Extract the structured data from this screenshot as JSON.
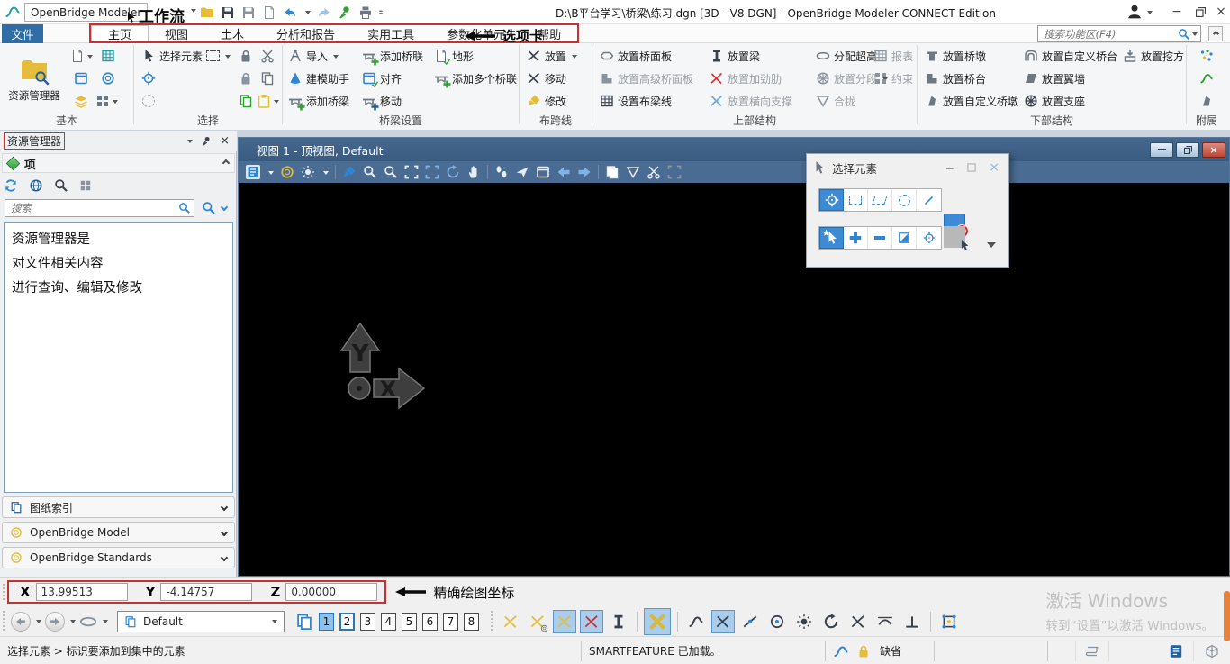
{
  "titlebar": {
    "app_button": "OpenBridge Modeler",
    "workflow_note": "工作流",
    "doc_title": "D:\\B平台学习\\桥梁\\练习.dgn [3D - V8 DGN] - OpenBridge Modeler CONNECT Edition"
  },
  "tabrow": {
    "file_tab": "文件",
    "tabs": [
      "主页",
      "视图",
      "土木",
      "分析和报告",
      "实用工具",
      "参数化单元",
      "帮助"
    ],
    "tabs_note": "选项卡",
    "search_placeholder": "搜索功能区(F4)"
  },
  "ribbon": {
    "basic": {
      "label": "基本",
      "explorer": "资源管理器"
    },
    "select": {
      "label": "选择",
      "select_element": "选择元素"
    },
    "bridge_setup": {
      "label": "桥梁设置",
      "import": "导入",
      "assistant": "建模助手",
      "add_bridge": "添加桥梁",
      "add_unit": "添加桥联",
      "align": "对齐",
      "move": "移动",
      "terrain": "地形",
      "add_multi": "添加多个桥联"
    },
    "span_line": {
      "label": "布跨线",
      "place": "放置",
      "move": "移动",
      "modify": "修改"
    },
    "superstructure": {
      "label": "上部结构",
      "deck": "放置桥面板",
      "adv_deck": "放置高级桥面板",
      "beam_layout": "设置布梁线",
      "beam": "放置梁",
      "stiffener": "放置加劲肋",
      "cross_frame": "放置横向支撑",
      "superelevation": "分配超高",
      "segment": "放置分段",
      "closure": "合拢",
      "report": "报表",
      "constraint": "约束"
    },
    "substructure": {
      "label": "下部结构",
      "pier": "放置桥墩",
      "abutment": "放置桥台",
      "custom_pier": "放置自定义桥墩",
      "custom_abutment": "放置自定义桥台",
      "wingwall": "放置翼墙",
      "bearing": "放置支座",
      "excavation": "放置挖方"
    },
    "accessory": {
      "label": "附属"
    }
  },
  "explorer": {
    "title": "资源管理器",
    "items_section": "项",
    "search_placeholder": "搜索",
    "desc_line1": "资源管理器是",
    "desc_line2": "对文件相关内容",
    "desc_line3": "进行查询、编辑及修改",
    "sheet_index": "图纸索引",
    "obm_model": "OpenBridge Model",
    "obm_standards": "OpenBridge Standards"
  },
  "view": {
    "title": "视图 1 - 顶视图, Default"
  },
  "select_dialog": {
    "title": "选择元素"
  },
  "coords": {
    "x_label": "X",
    "x_value": "13.99513",
    "y_label": "Y",
    "y_value": "-4.14757",
    "z_label": "Z",
    "z_value": "0.00000",
    "note": "精确绘图坐标"
  },
  "bottom": {
    "view_group": "Default",
    "view_numbers": [
      "1",
      "2",
      "3",
      "4",
      "5",
      "6",
      "7",
      "8"
    ]
  },
  "statusbar": {
    "prompt": "选择元素 > 标识要添加到集中的元素",
    "message": "SMARTFEATURE 已加载。",
    "level": "缺省"
  },
  "watermark": {
    "line1": "激活 Windows",
    "line2": "转到“设置”以激活 Windows。"
  },
  "colors": {
    "accent_blue": "#2e86d2",
    "file_tab_blue": "#2e6da6",
    "annotation_red": "#c93030",
    "view_title": "#3d6185",
    "canvas": "#000000",
    "active_tool": "#3d8bd4"
  }
}
